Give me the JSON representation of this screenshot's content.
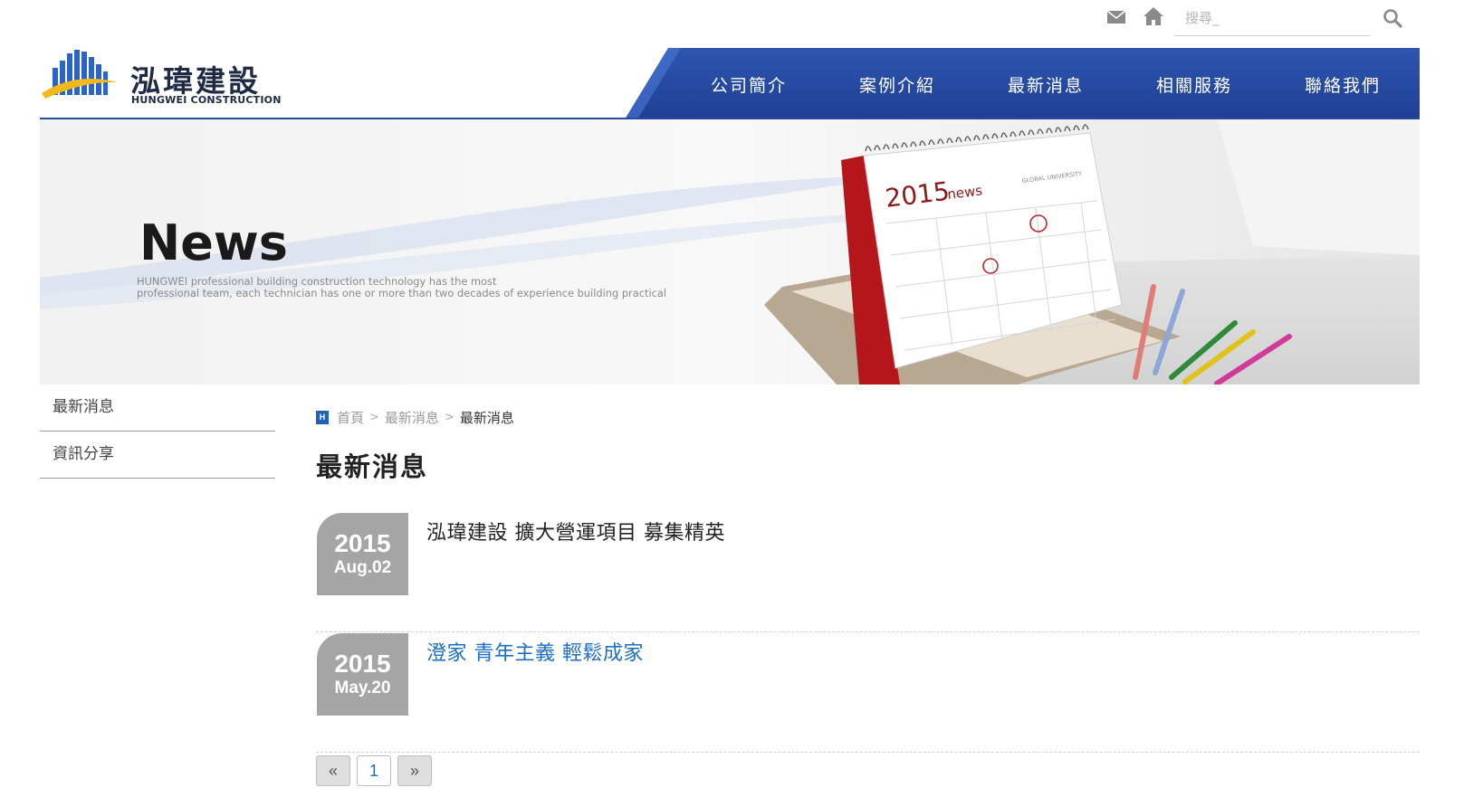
{
  "search": {
    "placeholder": "搜尋_"
  },
  "logo": {
    "cn": "泓瑋建設",
    "en": "HUNGWEI CONSTRUCTION"
  },
  "nav": {
    "items": [
      {
        "label": "公司簡介"
      },
      {
        "label": "案例介紹"
      },
      {
        "label": "最新消息"
      },
      {
        "label": "相關服務"
      },
      {
        "label": "聯絡我們"
      }
    ]
  },
  "banner": {
    "title": "News",
    "text_line1": "HUNGWEI professional building construction technology has the most",
    "text_line2": "professional team, each technician has one or more than two decades of experience building practical",
    "calendar_year": "2015",
    "calendar_word": "news",
    "calendar_caption": "GLOBAL UNIVERSITY"
  },
  "sidebar": {
    "items": [
      {
        "label": "最新消息"
      },
      {
        "label": "資訊分享"
      }
    ]
  },
  "breadcrumb": {
    "icon_letter": "H",
    "home": "首頁",
    "parent": "最新消息",
    "current": "最新消息",
    "separator": ">"
  },
  "page": {
    "title": "最新消息"
  },
  "news": {
    "items": [
      {
        "year": "2015",
        "md": "Aug.02",
        "title": "泓瑋建設 擴大營運項目 募集精英"
      },
      {
        "year": "2015",
        "md": "May.20",
        "title": "澄家 青年主義 輕鬆成家"
      }
    ]
  },
  "pagination": {
    "prev": "«",
    "page": "1",
    "next": "»"
  },
  "colors": {
    "nav_blue": "#2649a3",
    "link_blue": "#1e6ec4",
    "badge_gray": "#a5a5a5"
  }
}
